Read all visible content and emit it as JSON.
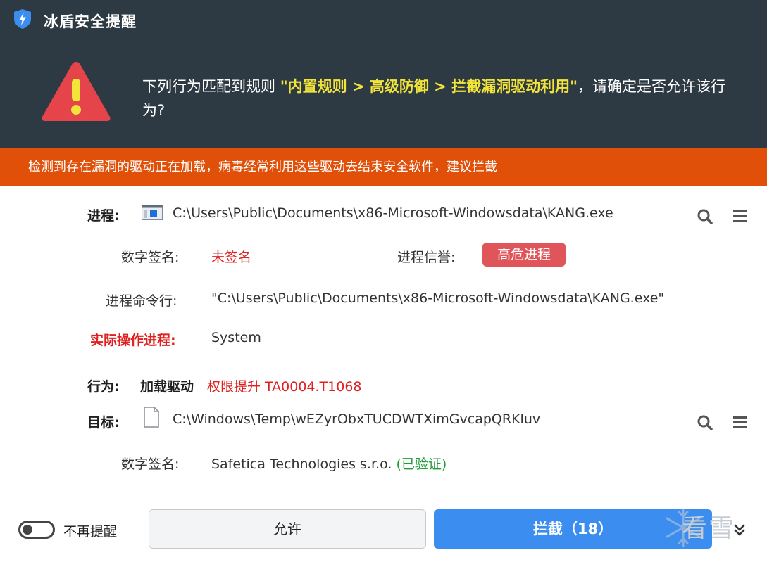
{
  "app": {
    "title": "冰盾安全提醒",
    "accent_color": "#3b8ef0",
    "header_bg": "#2e3a43",
    "banner_bg": "#e05008",
    "logo_icon": "shield-lightning-icon"
  },
  "alert": {
    "icon": "warning-triangle-icon",
    "msg_prefix": "下列行为匹配到规则 ",
    "rule": "\"内置规则 > 高级防御 > 拦截漏洞驱动利用\"",
    "msg_suffix": "，请确定是否允许该行为?",
    "banner": "检测到存在漏洞的驱动正在加载，病毒经常利用这些驱动去结束安全软件，建议拦截"
  },
  "process": {
    "label": "进程:",
    "icon": "window-app-icon",
    "path": "C:\\Users\\Public\\Documents\\x86-Microsoft-Windowsdata\\KANG.exe",
    "signature_label": "数字签名:",
    "signature_value": "未签名",
    "reputation_label": "进程信誉:",
    "reputation_value": "高危进程",
    "cmdline_label": "进程命令行:",
    "cmdline_value": "\"C:\\Users\\Public\\Documents\\x86-Microsoft-Windowsdata\\KANG.exe\"",
    "actual_label": "实际操作进程:",
    "actual_value": "System"
  },
  "behavior": {
    "label": "行为:",
    "action": "加载驱动",
    "tag": "权限提升 TA0004.T1068"
  },
  "target": {
    "label": "目标:",
    "icon": "file-icon",
    "path": "C:\\Windows\\Temp\\wEZyrObxTUCDWTXimGvcapQRKluv",
    "signature_label": "数字签名:",
    "signature_value": "Safetica Technologies s.r.o.",
    "signature_status": "(已验证)"
  },
  "footer": {
    "toggle_label": "不再提醒",
    "allow_label": "允许",
    "block_label": "拦截（18）",
    "watermark": "看雪"
  }
}
